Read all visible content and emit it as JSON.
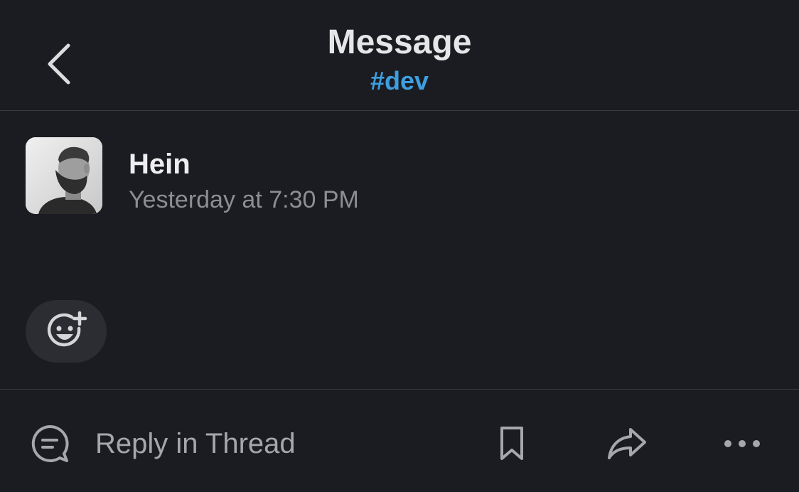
{
  "header": {
    "back_icon": "chevron-left-icon",
    "title": "Message",
    "channel": "#dev"
  },
  "message": {
    "author": "Hein",
    "timestamp": "Yesterday at 7:30 PM",
    "avatar_icon": "user-avatar",
    "add_reaction_icon": "add-emoji-icon"
  },
  "actions": {
    "reply_icon": "comment-bubble-icon",
    "reply_label": "Reply in Thread",
    "save_icon": "bookmark-icon",
    "share_icon": "share-arrow-icon",
    "more_icon": "more-horizontal-icon"
  },
  "colors": {
    "background": "#1b1c21",
    "channel_accent": "#3d9fe0",
    "muted_text": "#8d8e93",
    "divider": "#3a3b40"
  }
}
